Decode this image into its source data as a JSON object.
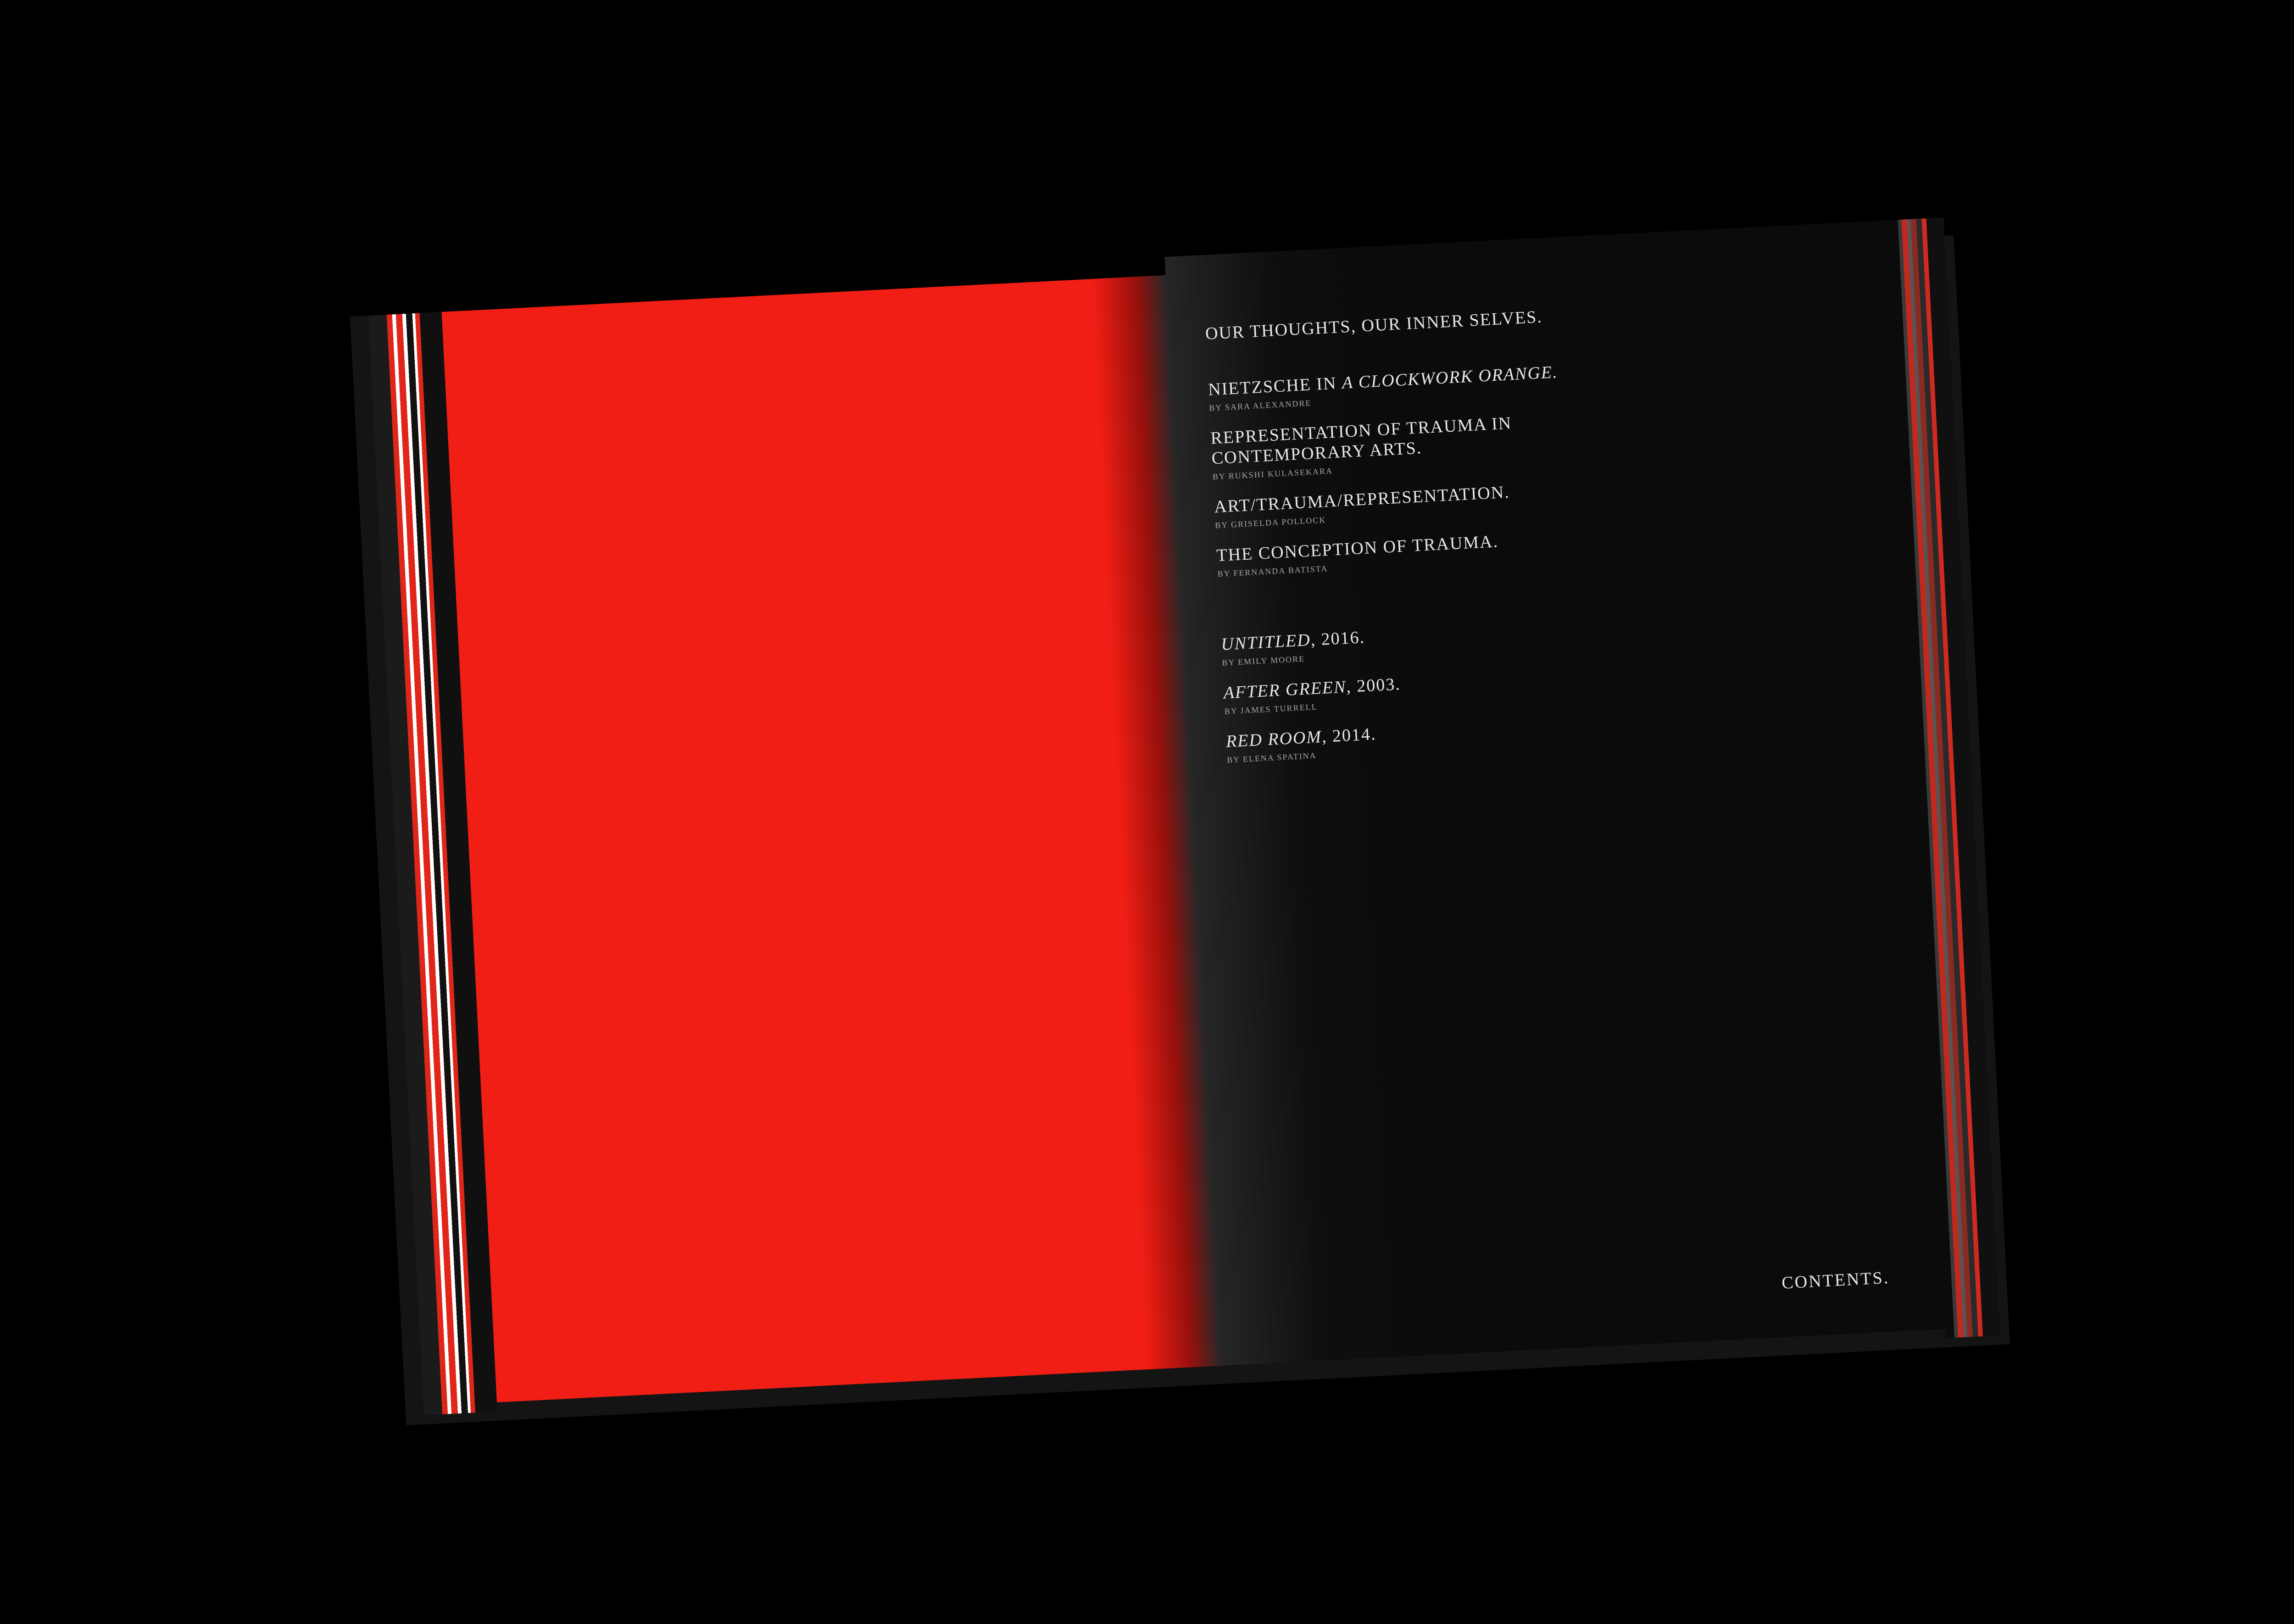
{
  "toc": {
    "intro": "OUR THOUGHTS, OUR INNER SELVES.",
    "essays": [
      {
        "title": "NIETZSCHE IN ",
        "title_italic": "A CLOCKWORK ORANGE.",
        "title_rest": "",
        "author": "BY SARA ALEXANDRE"
      },
      {
        "title": "REPRESENTATION OF TRAUMA IN CONTEMPORARY ARTS.",
        "title_italic": "",
        "title_rest": "",
        "author": "BY RUKSHI KULASEKARA"
      },
      {
        "title": "ART/TRAUMA/REPRESENTATION.",
        "title_italic": "",
        "title_rest": "",
        "author": "BY GRISELDA POLLOCK"
      },
      {
        "title": "THE CONCEPTION OF TRAUMA.",
        "title_italic": "",
        "title_rest": "",
        "author": "BY FERNANDA BATISTA"
      }
    ],
    "works": [
      {
        "title_italic": "UNTITLED",
        "title_rest": ", 2016.",
        "author": "BY EMILY MOORE"
      },
      {
        "title_italic": "AFTER GREEN",
        "title_rest": ", 2003.",
        "author": "BY JAMES TURRELL"
      },
      {
        "title_italic": "RED ROOM",
        "title_rest": ", 2014.",
        "author": "BY ELENA SPATINA"
      }
    ]
  },
  "footer": {
    "label": "CONTENTS."
  },
  "colors": {
    "left_page": "#f01e14",
    "right_page": "#0b0b0b",
    "background": "#000000",
    "text": "#e8e8e8"
  }
}
